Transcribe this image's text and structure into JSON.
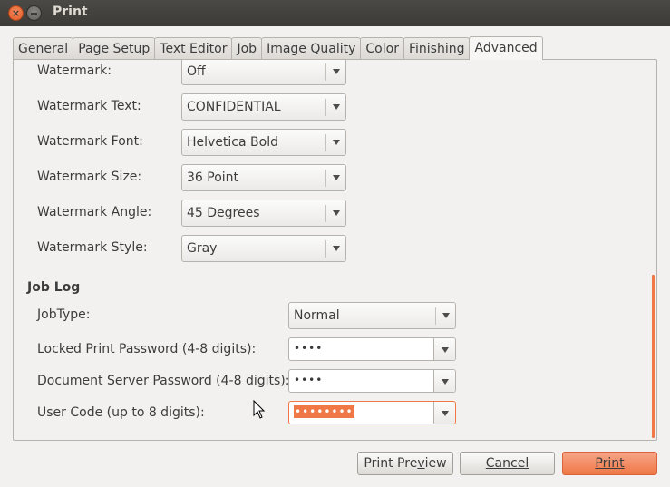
{
  "window": {
    "title": "Print"
  },
  "tabs": [
    "General",
    "Page Setup",
    "Text Editor",
    "Job",
    "Image Quality",
    "Color",
    "Finishing",
    "Advanced"
  ],
  "active_tab": "Advanced",
  "watermark": {
    "rows": [
      {
        "label": "Watermark:",
        "value": "Off"
      },
      {
        "label": "Watermark Text:",
        "value": "CONFIDENTIAL"
      },
      {
        "label": "Watermark Font:",
        "value": "Helvetica Bold"
      },
      {
        "label": "Watermark Size:",
        "value": "36 Point"
      },
      {
        "label": "Watermark Angle:",
        "value": "45 Degrees"
      },
      {
        "label": "Watermark Style:",
        "value": "Gray"
      }
    ]
  },
  "job_log": {
    "title": "Job Log",
    "jobtype": {
      "label": "JobType:",
      "value": "Normal"
    },
    "locked_password": {
      "label": "Locked Print Password (4-8 digits):",
      "value": "••••"
    },
    "doc_server_password": {
      "label": "Document Server Password (4-8 digits):",
      "value": "••••"
    },
    "user_code": {
      "label": "User Code (up to 8 digits):",
      "value": "••••••••"
    }
  },
  "buttons": {
    "preview_a": "Print Pre",
    "preview_u": "v",
    "preview_b": "iew",
    "cancel": "Cancel",
    "print": "Print"
  },
  "colors": {
    "accent": "#f07746",
    "titlebar": "#3c3b37"
  }
}
